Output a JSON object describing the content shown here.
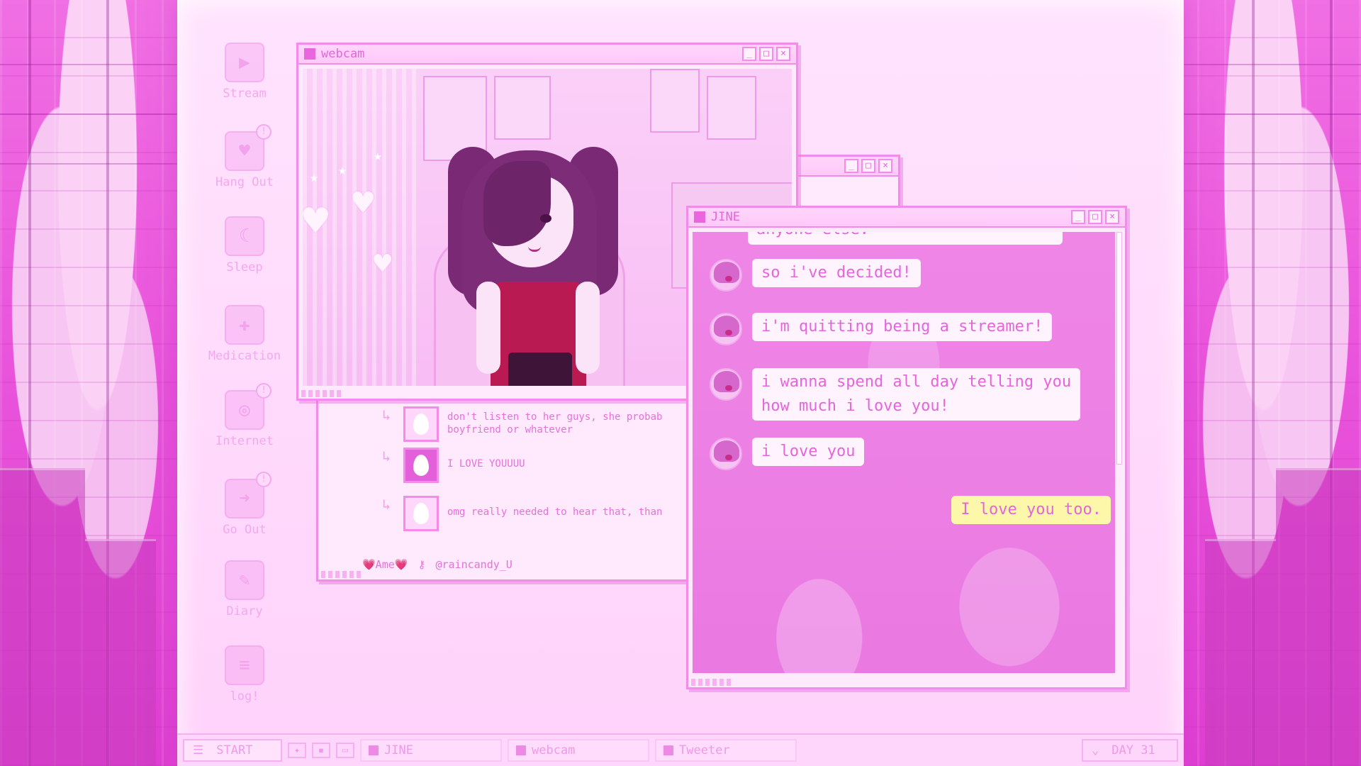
{
  "desktop": {
    "icons": [
      {
        "label": "Stream",
        "icon": "stream-icon",
        "alert": false
      },
      {
        "label": "Hang Out",
        "icon": "hangout-icon",
        "alert": true
      },
      {
        "label": "Sleep",
        "icon": "sleep-icon",
        "alert": false
      },
      {
        "label": "Medication",
        "icon": "medication-icon",
        "alert": false
      },
      {
        "label": "Internet",
        "icon": "internet-icon",
        "alert": true
      },
      {
        "label": "Go Out",
        "icon": "go-out-icon",
        "alert": true
      },
      {
        "label": "Diary",
        "icon": "diary-icon",
        "alert": false
      },
      {
        "label": "log!",
        "icon": "log-icon",
        "alert": false
      }
    ],
    "alert_glyph": "!"
  },
  "webcam_window": {
    "title": "webcam",
    "minimize": "_",
    "maximize": "□",
    "close": "×"
  },
  "tweeter_window": {
    "replies": [
      {
        "text": "don't listen to her guys, she probab boyfriend or whatever",
        "avatar_dark": false
      },
      {
        "text": "I LOVE YOUUUU",
        "avatar_dark": true
      },
      {
        "text": "omg really needed to hear that, than",
        "avatar_dark": false
      }
    ],
    "footer_name": "💗Ame💗",
    "footer_handle": "@raincandy_U"
  },
  "jine_window": {
    "title": "JINE",
    "partial_message": "anyone else.",
    "messages": [
      {
        "from": "ame",
        "text": "so i've decided!"
      },
      {
        "from": "ame",
        "text": "i'm quitting being a streamer!"
      },
      {
        "from": "ame",
        "text": "i wanna spend all day telling you\nhow much i love you!"
      },
      {
        "from": "ame",
        "text": "i love you"
      },
      {
        "from": "me",
        "text": "I love you too."
      }
    ]
  },
  "taskbar": {
    "start_label": "START",
    "tasks": [
      {
        "label": "JINE"
      },
      {
        "label": "webcam"
      },
      {
        "label": "Tweeter"
      }
    ],
    "day_label": "DAY 31"
  },
  "colors": {
    "accent": "#e367d9",
    "reply_bubble": "#fdf8a9",
    "background": "#f7b6f2"
  }
}
